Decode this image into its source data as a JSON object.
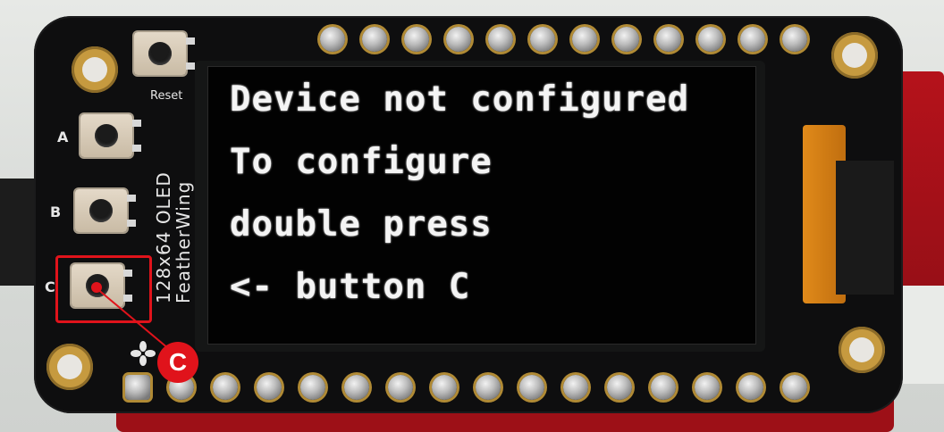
{
  "oled": {
    "lines": [
      "Device not configured",
      "To configure",
      "double press",
      "<- button C"
    ]
  },
  "board": {
    "reset_label": "Reset",
    "button_a_label": "A",
    "button_b_label": "B",
    "button_c_label": "C",
    "silkscreen_lines": [
      "128x64 OLED",
      "FeatherWing"
    ]
  },
  "annotation": {
    "badge_text": "C",
    "highlight_color": "#e0131b"
  }
}
